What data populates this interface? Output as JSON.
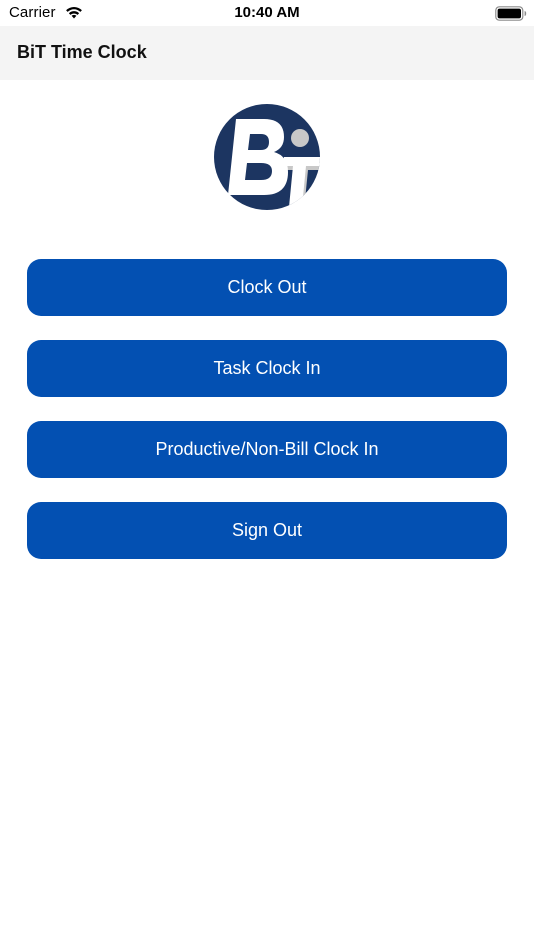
{
  "status_bar": {
    "carrier": "Carrier",
    "time": "10:40 AM",
    "wifi_icon": "wifi-icon",
    "battery_icon": "battery-icon"
  },
  "nav": {
    "title": "BiT Time Clock"
  },
  "logo": {
    "text": "BiT",
    "icon": "bit-logo",
    "colors": {
      "circle": "#1c3561",
      "letters": "#ffffff",
      "accent": "#c8c8c8"
    }
  },
  "buttons": {
    "clock_out": "Clock Out",
    "task_clock_in": "Task Clock In",
    "productive_clock_in": "Productive/Non-Bill Clock In",
    "sign_out": "Sign Out"
  },
  "colors": {
    "button_bg": "#0350b2",
    "button_text": "#ffffff",
    "nav_bg": "#f4f4f4"
  }
}
